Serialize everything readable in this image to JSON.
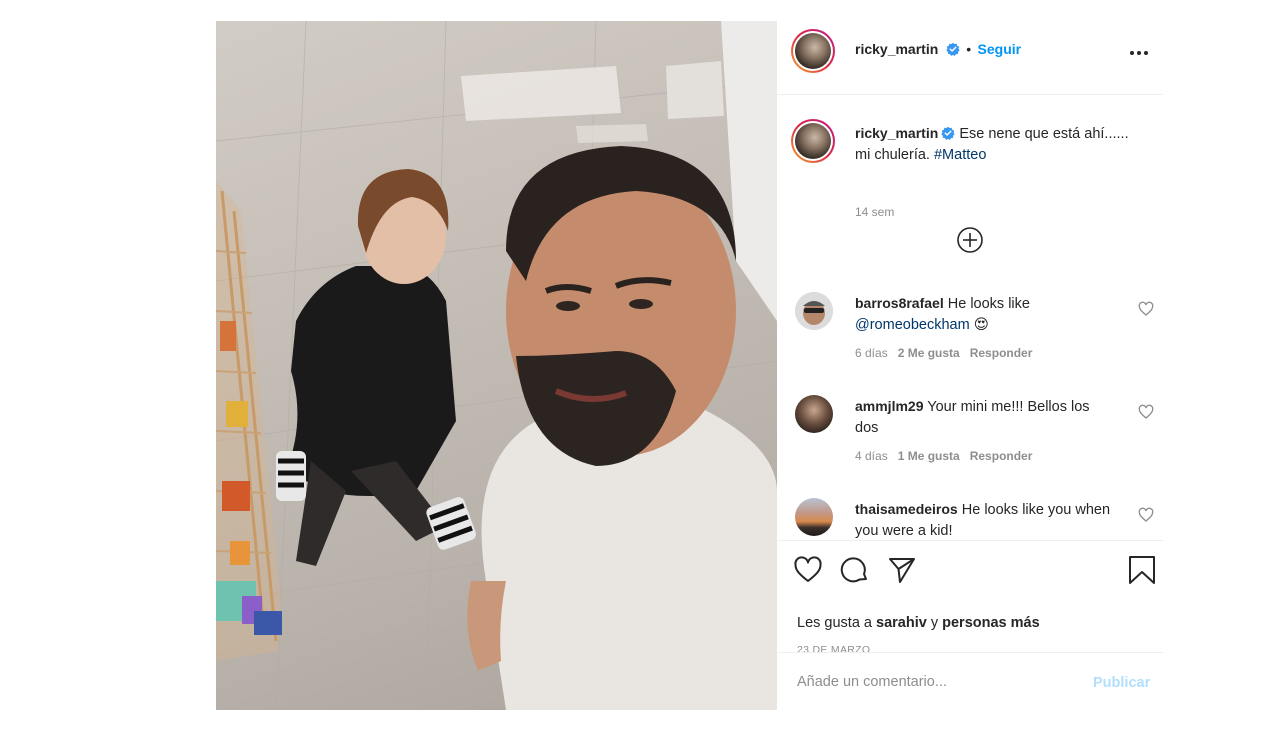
{
  "header": {
    "username": "ricky_martin",
    "separator": "•",
    "follow_label": "Seguir"
  },
  "caption": {
    "username": "ricky_martin",
    "text": "Ese nene que está ahí...... mi chulería.",
    "hashtag": "#Matteo",
    "time": "14 sem"
  },
  "comments": [
    {
      "username": "barros8rafael",
      "text": "He looks like",
      "mention": "@romeobeckham",
      "emoji": "😍",
      "time": "6 días",
      "likes": "2 Me gusta",
      "reply": "Responder"
    },
    {
      "username": "ammjlm29",
      "text": "Your mini me!!! Bellos los dos",
      "time": "4 días",
      "likes": "1 Me gusta",
      "reply": "Responder"
    },
    {
      "username": "thaisamedeiros",
      "text": "He looks like you when you were a kid!"
    }
  ],
  "likes": {
    "prefix": "Les gusta a",
    "user": "sarahiv",
    "middle": "y",
    "suffix": "personas más"
  },
  "date": "23 DE MARZO",
  "add_comment": {
    "placeholder": "Añade un comentario...",
    "publish_label": "Publicar"
  },
  "icons": {
    "verified": "verified-badge-icon",
    "more": "more-options-icon",
    "load_more": "plus-circle-icon",
    "like": "heart-icon",
    "comment": "comment-bubble-icon",
    "share": "paper-plane-icon",
    "save": "bookmark-icon"
  },
  "colors": {
    "accent": "#0095f6",
    "text": "#262626",
    "muted": "#8e8e8e",
    "hashtag": "#00376b",
    "publish_disabled": "#b2dffc"
  }
}
